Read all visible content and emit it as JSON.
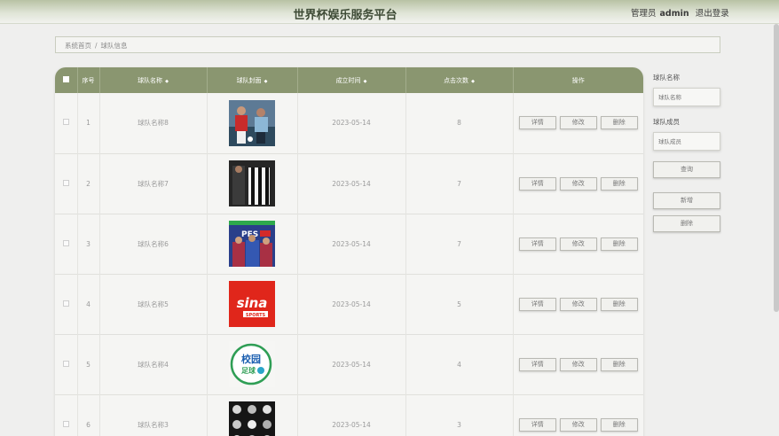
{
  "header": {
    "title": "世界杯娱乐服务平台",
    "role": "管理员",
    "username": "admin",
    "logout_label": "退出登录"
  },
  "breadcrumb": {
    "home": "系统首页",
    "separator": "/",
    "current": "球队信息"
  },
  "table": {
    "columns": {
      "index": "序号",
      "name": "球队名称",
      "cover": "球队封面",
      "date": "成立时间",
      "clicks": "点击次数",
      "ops": "操作"
    },
    "sort_arrow": "◆",
    "rows": [
      {
        "index": "1",
        "name": "球队名称8",
        "date": "2023-05-14",
        "clicks": "8",
        "cover": "soccer-players-photo"
      },
      {
        "index": "2",
        "name": "球队名称7",
        "date": "2023-05-14",
        "clicks": "7",
        "cover": "striped-jersey-photo"
      },
      {
        "index": "3",
        "name": "球队名称6",
        "date": "2023-05-14",
        "clicks": "7",
        "cover": "pes-game-cover"
      },
      {
        "index": "4",
        "name": "球队名称5",
        "date": "2023-05-14",
        "clicks": "5",
        "cover": "sina-sports-logo"
      },
      {
        "index": "5",
        "name": "球队名称4",
        "date": "2023-05-14",
        "clicks": "4",
        "cover": "campus-football-logo"
      },
      {
        "index": "6",
        "name": "球队名称3",
        "date": "2023-05-14",
        "clicks": "3",
        "cover": "club-badges-grid"
      }
    ],
    "actions": {
      "detail": "详情",
      "edit": "修改",
      "delete": "删除"
    }
  },
  "sidebar": {
    "name_label": "球队名称",
    "name_placeholder": "球队名称",
    "member_label": "球队成员",
    "member_placeholder": "球队成员",
    "query_label": "查询",
    "add_label": "新增",
    "delete_label": "删除"
  },
  "covers": {
    "pes_logo_text": "PES",
    "sina_text": "sina",
    "sina_sub": "SPORTS",
    "campus_text_1": "校园",
    "campus_text_2": "足球"
  },
  "colors": {
    "header_accent": "#8a9670",
    "sina_red": "#e0261b"
  }
}
